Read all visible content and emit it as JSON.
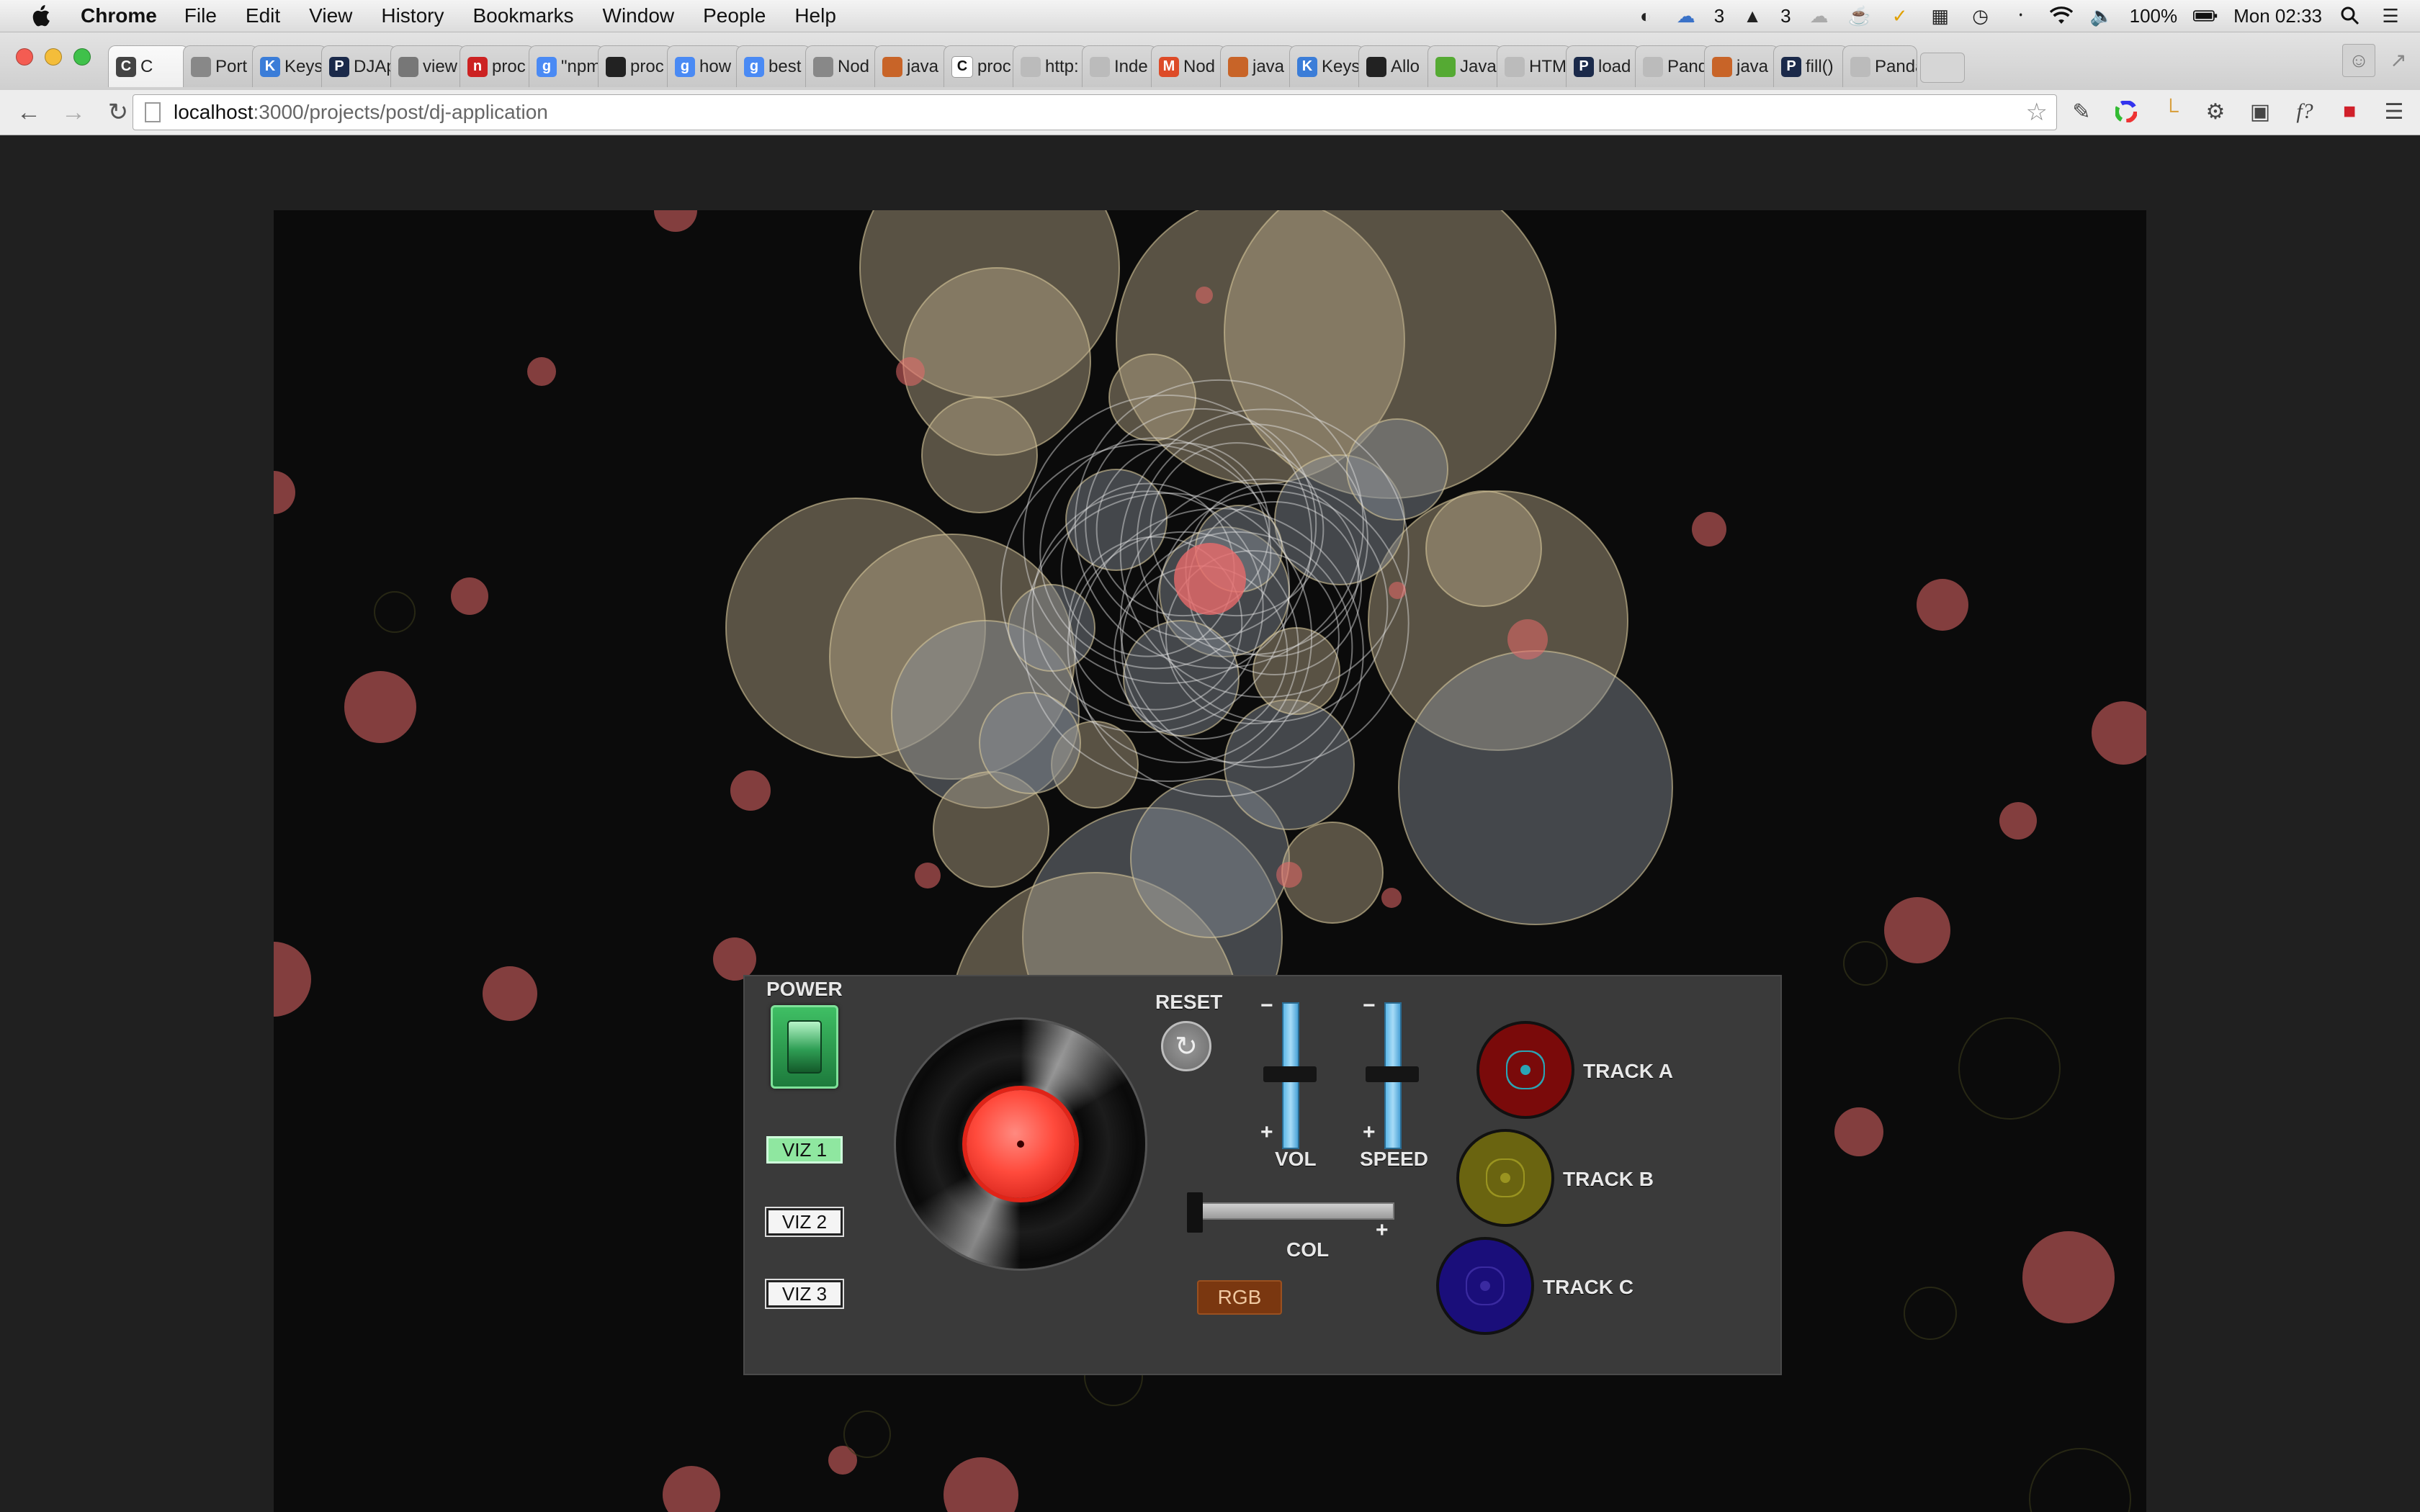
{
  "menubar": {
    "app_name": "Chrome",
    "menus": [
      "File",
      "Edit",
      "View",
      "History",
      "Bookmarks",
      "Window",
      "People",
      "Help"
    ],
    "badge_1": "3",
    "badge_2": "3",
    "battery": "100%",
    "clock": "Mon 02:33"
  },
  "tabs": [
    {
      "label": "C",
      "favicon": "C",
      "color": "#444444"
    },
    {
      "label": "Port",
      "favicon": "",
      "color": "#888888"
    },
    {
      "label": "Keys",
      "favicon": "K",
      "color": "#3b7dd8"
    },
    {
      "label": "DJAp",
      "favicon": "P",
      "color": "#1b2a4a"
    },
    {
      "label": "view",
      "favicon": "",
      "color": "#777777"
    },
    {
      "label": "proc",
      "favicon": "n",
      "color": "#cc2222"
    },
    {
      "label": "\"npm",
      "favicon": "g",
      "color": "#4a8af4"
    },
    {
      "label": "proc",
      "favicon": "",
      "color": "#222222"
    },
    {
      "label": "how",
      "favicon": "g",
      "color": "#4a8af4"
    },
    {
      "label": "best",
      "favicon": "g",
      "color": "#4a8af4"
    },
    {
      "label": "Nod",
      "favicon": "",
      "color": "#888888"
    },
    {
      "label": "java",
      "favicon": "",
      "color": "#c86428"
    },
    {
      "label": "proc",
      "favicon": "C",
      "color": "#ffffff"
    },
    {
      "label": "http:",
      "favicon": "",
      "color": "#bbbbbb"
    },
    {
      "label": "Inde",
      "favicon": "",
      "color": "#bbbbbb"
    },
    {
      "label": "Nod",
      "favicon": "M",
      "color": "#dd4b28"
    },
    {
      "label": "java",
      "favicon": "",
      "color": "#c86428"
    },
    {
      "label": "Keys",
      "favicon": "K",
      "color": "#3b7dd8"
    },
    {
      "label": "Allo",
      "favicon": "",
      "color": "#222222"
    },
    {
      "label": "Java",
      "favicon": "",
      "color": "#55aa33"
    },
    {
      "label": "HTM",
      "favicon": "",
      "color": "#bbbbbb"
    },
    {
      "label": "load",
      "favicon": "P",
      "color": "#1b2a4a"
    },
    {
      "label": "Panda",
      "favicon": "",
      "color": "#bbbbbb"
    },
    {
      "label": "java",
      "favicon": "",
      "color": "#c86428"
    },
    {
      "label": "fill()",
      "favicon": "P",
      "color": "#1b2a4a"
    },
    {
      "label": "Panda",
      "favicon": "",
      "color": "#bbbbbb"
    }
  ],
  "address": {
    "host": "localhost",
    "path": ":3000/projects/post/dj-application"
  },
  "panel": {
    "power_label": "POWER",
    "viz_buttons": [
      "VIZ 1",
      "VIZ 2",
      "VIZ 3"
    ],
    "active_viz": "VIZ 1",
    "reset_label": "RESET",
    "vol": {
      "label": "VOL",
      "minus": "−",
      "plus": "+",
      "level": 0.5
    },
    "speed": {
      "label": "SPEED",
      "minus": "−",
      "plus": "+",
      "level": 0.5
    },
    "col": {
      "label": "COL",
      "plus": "+",
      "level": 0.0
    },
    "rgb_label": "RGB",
    "tracks": [
      {
        "label": "TRACK A",
        "color": "#7a0a0a",
        "center": "#2aa5b5"
      },
      {
        "label": "TRACK B",
        "color": "#6a6410",
        "center": "#9a9420"
      },
      {
        "label": "TRACK C",
        "color": "#1a0e7a",
        "center": "#3a2aa0"
      }
    ]
  },
  "colors": {
    "bubble_beige": "#b8a88a",
    "bubble_grey": "#8a9098",
    "bubble_red": "#e86a6a",
    "ring_white": "#e6e6e6"
  }
}
